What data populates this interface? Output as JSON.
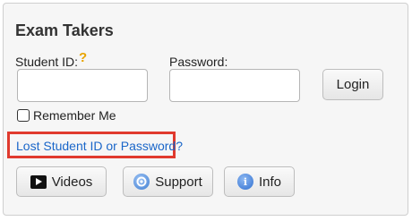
{
  "panel": {
    "title": "Exam Takers",
    "student_id_label": "Student ID:",
    "help_icon_glyph": "?",
    "password_label": "Password:",
    "student_id_value": "",
    "password_value": "",
    "login_label": "Login",
    "remember_label": "Remember Me",
    "remember_checked": false,
    "lost_link": "Lost Student ID or Password?",
    "buttons": {
      "videos": "Videos",
      "support": "Support",
      "info": "Info"
    },
    "icons": {
      "help": "question-mark-icon",
      "videos": "video-play-icon",
      "support": "support-lifebuoy-icon",
      "info": "info-icon"
    }
  },
  "colors": {
    "highlight_border": "#e03a2e",
    "link": "#1a66c9",
    "help_icon": "#e8a400"
  }
}
